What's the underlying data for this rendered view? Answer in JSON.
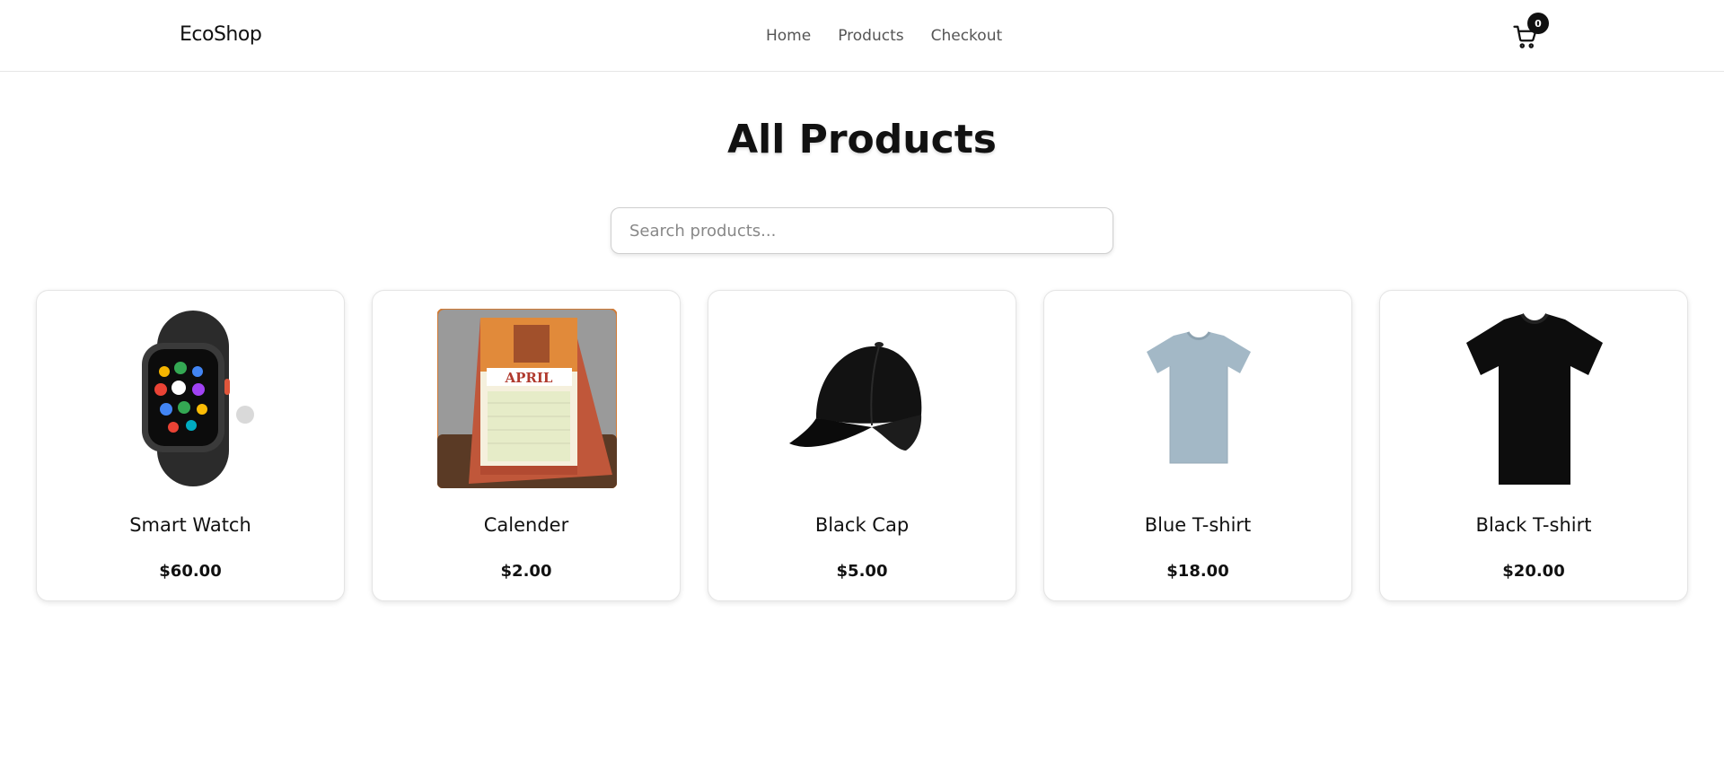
{
  "header": {
    "brand": "EcoShop",
    "nav": [
      {
        "label": "Home"
      },
      {
        "label": "Products"
      },
      {
        "label": "Checkout"
      }
    ],
    "cart_count": "0",
    "cart_icon": "cart-icon"
  },
  "main": {
    "title": "All Products",
    "search_placeholder": "Search products..."
  },
  "products": [
    {
      "name": "Smart Watch",
      "price": "$60.00",
      "image": "smart-watch-image"
    },
    {
      "name": "Calender",
      "price": "$2.00",
      "image": "calendar-image",
      "image_text": "APRIL"
    },
    {
      "name": "Black Cap",
      "price": "$5.00",
      "image": "black-cap-image"
    },
    {
      "name": "Blue T-shirt",
      "price": "$18.00",
      "image": "blue-tshirt-image"
    },
    {
      "name": "Black T-shirt",
      "price": "$20.00",
      "image": "black-tshirt-image"
    }
  ],
  "colors": {
    "text": "#111111",
    "muted": "#555555",
    "border": "#e4e4e4",
    "calendar_accent": "#c0573a",
    "tshirt_blue": "#a3b8c6"
  }
}
